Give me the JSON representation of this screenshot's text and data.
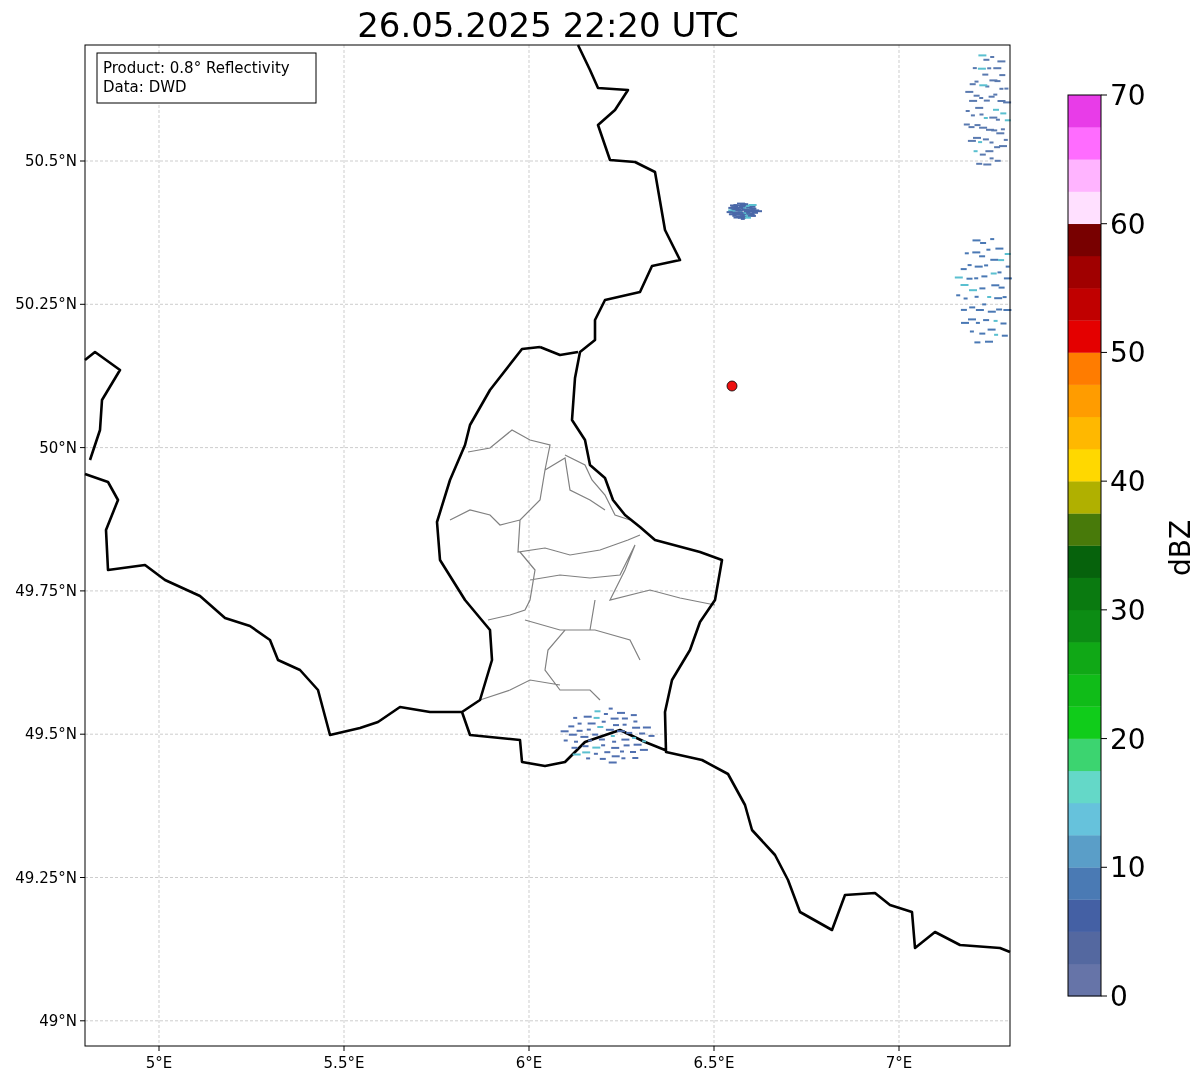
{
  "title": "26.05.2025 22:20 UTC",
  "annotation": [
    "Product: 0.8° Reflectivity",
    "Data: DWD"
  ],
  "map": {
    "y_ticks": [
      "50.5°N",
      "50.25°N",
      "50°N",
      "49.75°N",
      "49.5°N",
      "49.25°N",
      "49°N"
    ],
    "x_ticks": [
      "5°E",
      "5.5°E",
      "6°E",
      "6.5°E",
      "7°E"
    ]
  },
  "colorbar": {
    "label": "dBZ",
    "ticks": [
      "70",
      "60",
      "50",
      "40",
      "30",
      "20",
      "10",
      "0"
    ],
    "bins": [
      {
        "color": "#6674a8"
      },
      {
        "color": "#5468a0"
      },
      {
        "color": "#4460a4"
      },
      {
        "color": "#4a7ab4"
      },
      {
        "color": "#5a9ec8"
      },
      {
        "color": "#66c2dc"
      },
      {
        "color": "#64d8c8"
      },
      {
        "color": "#3cd470"
      },
      {
        "color": "#10cc1a"
      },
      {
        "color": "#10bc18"
      },
      {
        "color": "#10a816"
      },
      {
        "color": "#0c8c14"
      },
      {
        "color": "#0a7a10"
      },
      {
        "color": "#06620c"
      },
      {
        "color": "#487a0a"
      },
      {
        "color": "#b0b000"
      },
      {
        "color": "#ffd800"
      },
      {
        "color": "#ffb800"
      },
      {
        "color": "#ff9c00"
      },
      {
        "color": "#ff7c00"
      },
      {
        "color": "#e40000"
      },
      {
        "color": "#c00000"
      },
      {
        "color": "#a00000"
      },
      {
        "color": "#780000"
      },
      {
        "color": "#ffe0ff"
      },
      {
        "color": "#ffb4ff"
      },
      {
        "color": "#ff6cff"
      },
      {
        "color": "#e83ce8"
      }
    ]
  }
}
